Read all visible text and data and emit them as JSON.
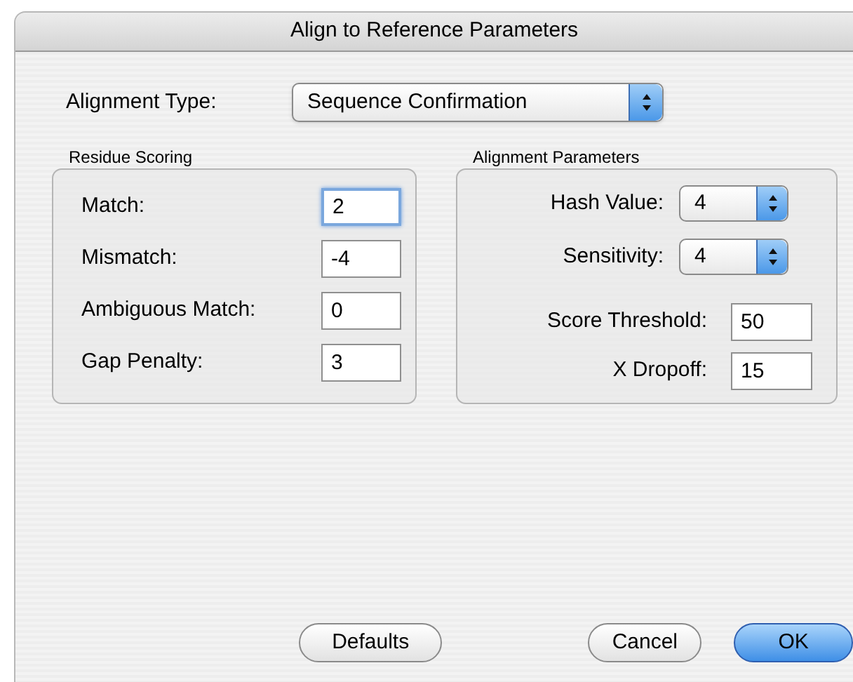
{
  "window": {
    "title": "Align to Reference Parameters"
  },
  "alignment_type": {
    "label": "Alignment Type:",
    "value": "Sequence Confirmation"
  },
  "residue_scoring": {
    "title": "Residue Scoring",
    "fields": [
      {
        "label": "Match:",
        "value": "2",
        "focused": true
      },
      {
        "label": "Mismatch:",
        "value": "-4",
        "focused": false
      },
      {
        "label": "Ambiguous Match:",
        "value": "0",
        "focused": false
      },
      {
        "label": "Gap Penalty:",
        "value": "3",
        "focused": false
      }
    ]
  },
  "alignment_parameters": {
    "title": "Alignment Parameters",
    "items": [
      {
        "kind": "popup",
        "label": "Hash Value:",
        "value": "4"
      },
      {
        "kind": "popup",
        "label": "Sensitivity:",
        "value": "4"
      },
      {
        "kind": "field",
        "label": "Score Threshold:",
        "value": "50",
        "focused": false
      },
      {
        "kind": "field",
        "label": "X Dropoff:",
        "value": "15",
        "focused": false
      }
    ]
  },
  "buttons": [
    {
      "label": "Defaults",
      "default": false
    },
    {
      "label": "Cancel",
      "default": false
    },
    {
      "label": "OK",
      "default": true
    }
  ]
}
